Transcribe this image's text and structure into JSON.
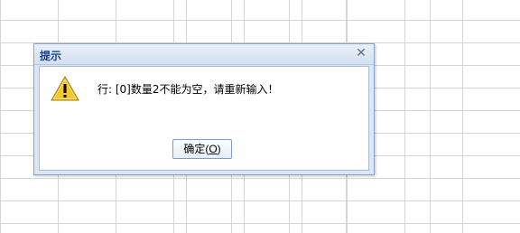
{
  "dialog": {
    "title": "提示",
    "close_glyph": "✕",
    "message": "行: [0]数量2不能为空，请重新输入！",
    "ok_label_prefix": "确定(",
    "ok_label_mnemonic": "O",
    "ok_label_suffix": ")",
    "icon": "warning-triangle-icon"
  },
  "colors": {
    "title_text": "#15428b",
    "dialog_frame": "#dbe6f4",
    "warning_fill": "#f3c62a"
  }
}
